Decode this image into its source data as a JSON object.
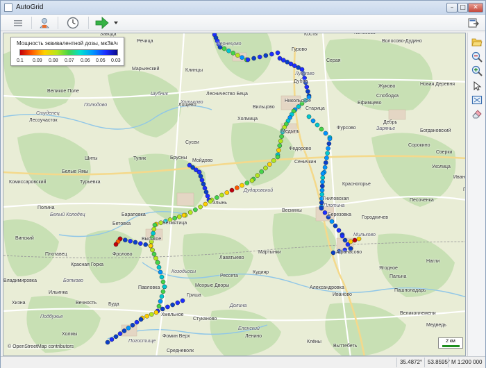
{
  "window": {
    "title": "AutoGrid"
  },
  "titlebar": {
    "min": "–",
    "max": "□",
    "close": "✕"
  },
  "toolbar": {
    "icons": [
      "hamburger-menu-icon",
      "operator-icon",
      "clock-icon",
      "play-arrow-icon",
      "dropdown-icon",
      "exit-icon"
    ],
    "colors": {
      "play": "#35b245"
    }
  },
  "legend": {
    "title": "Мощность эквивалентной дозы, мкЗв/ч",
    "ticks": [
      "0.1",
      "0.09",
      "0.08",
      "0.07",
      "0.06",
      "0.05",
      "0.03"
    ]
  },
  "map": {
    "attribution": "© OpenStreetMap contributors",
    "scale_label": "2 км",
    "labels": [
      {
        "t": "Завода",
        "i": false
      },
      {
        "t": "Речица",
        "i": false
      },
      {
        "t": "Чернецово",
        "i": true
      },
      {
        "t": "Косты",
        "i": false
      },
      {
        "t": "Колосово",
        "i": false
      },
      {
        "t": "Волосово-Дудино",
        "i": false
      },
      {
        "t": "Марьинский",
        "i": false
      },
      {
        "t": "Клинцы",
        "i": false
      },
      {
        "t": "Гурово",
        "i": false
      },
      {
        "t": "Серая",
        "i": false
      },
      {
        "t": "Лужково",
        "i": true
      },
      {
        "t": "Дубна",
        "i": false
      },
      {
        "t": "Жуково",
        "i": false
      },
      {
        "t": "Новая Деревня",
        "i": false
      },
      {
        "t": "Великое Поле",
        "i": false
      },
      {
        "t": "Полюдово",
        "i": true
      },
      {
        "t": "Шубник",
        "i": true
      },
      {
        "t": "Лесничество Беца",
        "i": false
      },
      {
        "t": "Ефимцево",
        "i": false
      },
      {
        "t": "Слободка",
        "i": false
      },
      {
        "t": "Студенец",
        "i": true
      },
      {
        "t": "Лесоучасток",
        "i": false
      },
      {
        "t": "Хотьково",
        "i": true
      },
      {
        "t": "Лощево",
        "i": false
      },
      {
        "t": "Вильцово",
        "i": false
      },
      {
        "t": "Никольское",
        "i": false
      },
      {
        "t": "Старица",
        "i": false
      },
      {
        "t": "Дебрь",
        "i": false
      },
      {
        "t": "Зарянье",
        "i": true
      },
      {
        "t": "Холмица",
        "i": false
      },
      {
        "t": "Медынь",
        "i": false
      },
      {
        "t": "Фурсово",
        "i": false
      },
      {
        "t": "Богдановский",
        "i": false
      },
      {
        "t": "Сусеи",
        "i": false
      },
      {
        "t": "Сорокино",
        "i": false
      },
      {
        "t": "Озерки",
        "i": false
      },
      {
        "t": "Шиты",
        "i": false
      },
      {
        "t": "Тупик",
        "i": false
      },
      {
        "t": "Брусны",
        "i": false
      },
      {
        "t": "Мойдово",
        "i": false
      },
      {
        "t": "Федорово",
        "i": false
      },
      {
        "t": "Сеничкин",
        "i": false
      },
      {
        "t": "Уколица",
        "i": false
      },
      {
        "t": "Ивановка",
        "i": false
      },
      {
        "t": "Белые Ямы",
        "i": false
      },
      {
        "t": "Турьевка",
        "i": false
      },
      {
        "t": "Комиссаровский",
        "i": false
      },
      {
        "t": "Дударовский",
        "i": true
      },
      {
        "t": "Красногорье",
        "i": false
      },
      {
        "t": "Грабовка",
        "i": false
      },
      {
        "t": "Песоченка",
        "i": false
      },
      {
        "t": "Гниловская",
        "i": false
      },
      {
        "t": "Полина",
        "i": false
      },
      {
        "t": "Белый Колодец",
        "i": true
      },
      {
        "t": "Бараповка",
        "i": false
      },
      {
        "t": "Злынь",
        "i": false
      },
      {
        "t": "Весиины",
        "i": false
      },
      {
        "t": "Плотина",
        "i": true
      },
      {
        "t": "Городничев",
        "i": false
      },
      {
        "t": "Бетовка",
        "i": false
      },
      {
        "t": "Безмятица",
        "i": false
      },
      {
        "t": "Березовка",
        "i": false
      },
      {
        "t": "Высокое",
        "i": false
      },
      {
        "t": "Мильково",
        "i": true
      },
      {
        "t": "Винский",
        "i": false
      },
      {
        "t": "Мартынки",
        "i": false
      },
      {
        "t": "Афанасово",
        "i": false
      },
      {
        "t": "Плотавец",
        "i": false
      },
      {
        "t": "Фролово",
        "i": false
      },
      {
        "t": "Лаватыево",
        "i": false
      },
      {
        "t": "Нагли",
        "i": false
      },
      {
        "t": "Красная Горка",
        "i": false
      },
      {
        "t": "Козодьосы",
        "i": true
      },
      {
        "t": "Кудияр",
        "i": false
      },
      {
        "t": "Ягодное",
        "i": false
      },
      {
        "t": "Ботково",
        "i": true
      },
      {
        "t": "Владимировка",
        "i": false
      },
      {
        "t": "Рессета",
        "i": false
      },
      {
        "t": "Павловка",
        "i": false
      },
      {
        "t": "Мохрые Дворы",
        "i": false
      },
      {
        "t": "Александровка",
        "i": false
      },
      {
        "t": "Пальна",
        "i": false
      },
      {
        "t": "Пашполадарь",
        "i": false
      },
      {
        "t": "Ильинка",
        "i": false
      },
      {
        "t": "Иваново",
        "i": false
      },
      {
        "t": "Гриша",
        "i": false
      },
      {
        "t": "Вечность",
        "i": false
      },
      {
        "t": "Буда",
        "i": false
      },
      {
        "t": "Хмельное",
        "i": false
      },
      {
        "t": "Долина",
        "i": true
      },
      {
        "t": "Великоплемени",
        "i": false
      },
      {
        "t": "Подбужье",
        "i": true
      },
      {
        "t": "Медведь",
        "i": false
      },
      {
        "t": "Стуканово",
        "i": false
      },
      {
        "t": "Хизна",
        "i": false
      },
      {
        "t": "Еленский",
        "i": true
      },
      {
        "t": "Холмы",
        "i": false
      },
      {
        "t": "Фомин Верх",
        "i": false
      },
      {
        "t": "Ленино",
        "i": false
      },
      {
        "t": "Клёны",
        "i": false
      },
      {
        "t": "Выттебеть",
        "i": false
      },
      {
        "t": "Средневолк",
        "i": false
      },
      {
        "t": "Погостище",
        "i": true
      }
    ]
  },
  "sidebar": {
    "icons": [
      "open-folder-icon",
      "zoom-out-icon",
      "zoom-in-icon",
      "pointer-icon",
      "zoom-extent-icon",
      "eraser-icon"
    ]
  },
  "status": {
    "longitude": "35.4872°",
    "latitude": "53.8595°",
    "scale": "М 1:200 000"
  }
}
